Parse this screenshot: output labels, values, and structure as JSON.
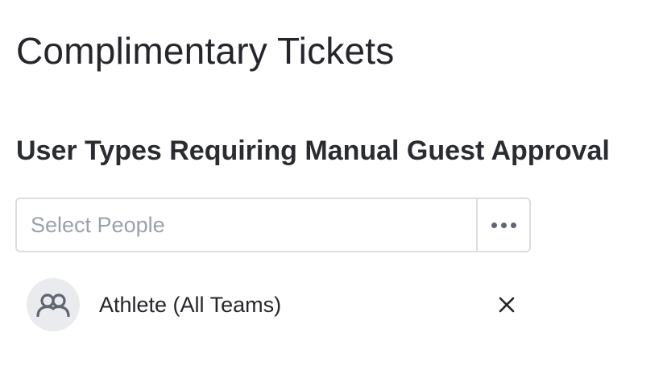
{
  "page": {
    "title": "Complimentary Tickets"
  },
  "section": {
    "title": "User Types Requiring Manual Guest Approval"
  },
  "picker": {
    "placeholder": "Select People",
    "value": "",
    "more_icon": "ellipsis-horizontal-icon"
  },
  "selected": [
    {
      "label": "Athlete (All Teams)",
      "icon": "group-users-icon",
      "remove_icon": "close-icon"
    }
  ],
  "colors": {
    "text": "#24262b",
    "border": "#dcdde1",
    "placeholder": "#9aa1ad",
    "avatar_bg": "#eaebef",
    "icon": "#5f6672"
  }
}
